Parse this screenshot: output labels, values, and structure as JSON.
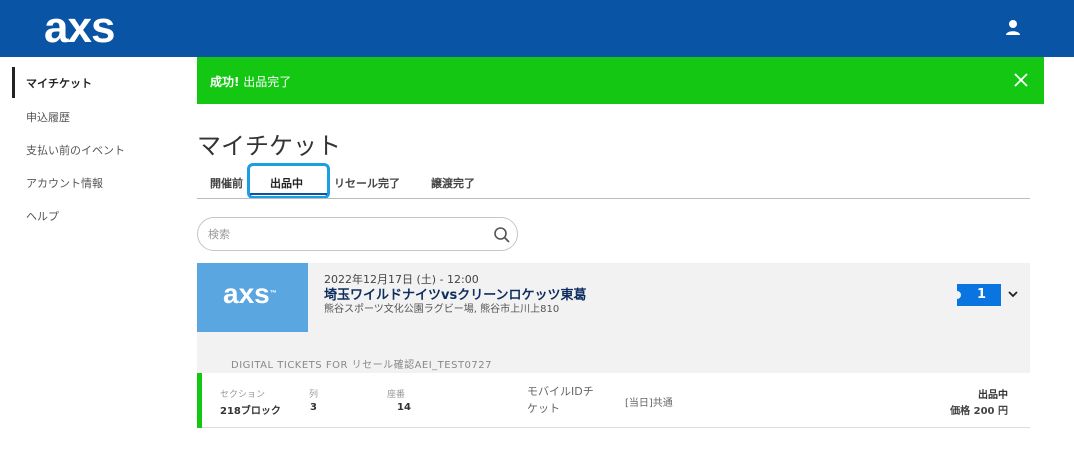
{
  "header": {
    "logo": "axs"
  },
  "sidebar": {
    "items": [
      {
        "label": "マイチケット"
      },
      {
        "label": "申込履歴"
      },
      {
        "label": "支払い前のイベント"
      },
      {
        "label": "アカウント情報"
      },
      {
        "label": "ヘルプ"
      }
    ]
  },
  "alert": {
    "title": "成功!",
    "message": " 出品完了"
  },
  "main": {
    "title": "マイチケット",
    "tabs": [
      {
        "label": "開催前"
      },
      {
        "label": "出品中"
      },
      {
        "label": "リセール完了"
      },
      {
        "label": "譲渡完了"
      }
    ],
    "search": {
      "placeholder": "検索"
    }
  },
  "event": {
    "thumb_logo": "axs",
    "date": "2022年12月17日 (土) - 12:00",
    "title": "埼玉ワイルドナイツvsクリーンロケッツ東葛",
    "venue": "熊谷スポーツ文化公園ラグビー場, 熊谷市上川上810",
    "ticket_count": "1",
    "digital_label": "DIGITAL TICKETS FOR リセール確認AEI_TEST0727"
  },
  "ticket": {
    "section_label": "セクション",
    "section_value": "218ブロック",
    "row_label": "列",
    "row_value": "3",
    "seat_label": "座番",
    "seat_value": "14",
    "type": "モバイルIDチケット",
    "note": "[当日]共通",
    "status": "出品中",
    "price": "価格 200 円"
  },
  "colors": {
    "brand": "#0a54a6",
    "success": "#13c713",
    "tab_highlight": "#1a9fe0",
    "thumb": "#5aa6e0"
  }
}
